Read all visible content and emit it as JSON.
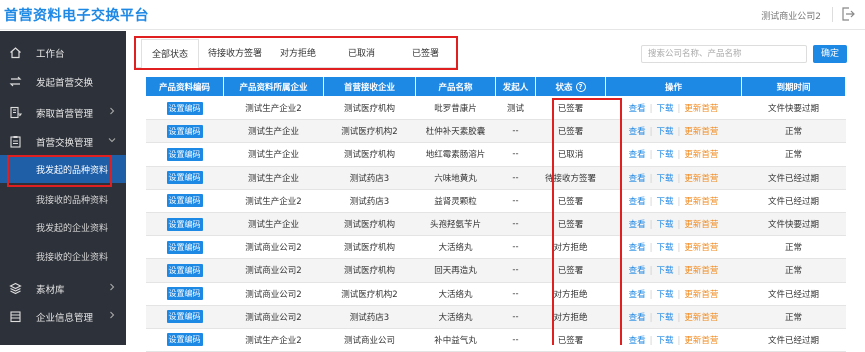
{
  "header": {
    "title": "首营资料电子交换平台",
    "company": "测试商业公司2"
  },
  "sidebar": {
    "items": [
      {
        "label": "工作台",
        "icon": "home-icon",
        "has_chevron": false
      },
      {
        "label": "发起首营交换",
        "icon": "exchange-icon",
        "has_chevron": false
      },
      {
        "label": "索取首营管理",
        "icon": "request-icon",
        "has_chevron": true
      },
      {
        "label": "首营交换管理",
        "icon": "clipboard-icon",
        "has_chevron": true,
        "expanded": true
      },
      {
        "label": "素材库",
        "icon": "layers-icon",
        "has_chevron": true
      },
      {
        "label": "企业信息管理",
        "icon": "building-icon",
        "has_chevron": true
      }
    ],
    "subitems": [
      {
        "label": "我发起的品种资料",
        "active": true
      },
      {
        "label": "我接收的品种资料",
        "active": false
      },
      {
        "label": "我发起的企业资料",
        "active": false
      },
      {
        "label": "我接收的企业资料",
        "active": false
      }
    ]
  },
  "tabs": [
    {
      "label": "全部状态",
      "active": true
    },
    {
      "label": "待接收方签署",
      "active": false
    },
    {
      "label": "对方拒绝",
      "active": false
    },
    {
      "label": "已取消",
      "active": false
    },
    {
      "label": "已签署",
      "active": false
    }
  ],
  "search": {
    "placeholder": "搜索公司名称、产品名称",
    "button_label": "确定"
  },
  "table": {
    "headers": [
      "产品资料编码",
      "产品资料所属企业",
      "首营接收企业",
      "产品名称",
      "发起人",
      "状态",
      "操作",
      "到期时间"
    ],
    "code_button_label": "设置编码",
    "actions": {
      "view": "查看",
      "download": "下载",
      "update": "更新首营"
    },
    "rows": [
      {
        "owner": "测试生产企业2",
        "receiver": "测试医疗机构",
        "product": "吡罗昔康片",
        "initiator": "测试",
        "status": "已签署",
        "expiry": "文件快要过期"
      },
      {
        "owner": "测试生产企业",
        "receiver": "测试医疗机构2",
        "product": "杜仲补天素胶囊",
        "initiator": "--",
        "status": "已签署",
        "expiry": "正常"
      },
      {
        "owner": "测试生产企业",
        "receiver": "测试医疗机构",
        "product": "地红霉素肠溶片",
        "initiator": "--",
        "status": "已取消",
        "expiry": "正常"
      },
      {
        "owner": "测试生产企业",
        "receiver": "测试药店3",
        "product": "六味地黄丸",
        "initiator": "--",
        "status": "待接收方签署",
        "expiry": "文件已经过期"
      },
      {
        "owner": "测试生产企业2",
        "receiver": "测试药店3",
        "product": "益肾灵颗粒",
        "initiator": "--",
        "status": "已签署",
        "expiry": "文件已经过期"
      },
      {
        "owner": "测试生产企业",
        "receiver": "测试医疗机构",
        "product": "头孢羟氨苄片",
        "initiator": "--",
        "status": "已签署",
        "expiry": "文件快要过期"
      },
      {
        "owner": "测试商业公司2",
        "receiver": "测试医疗机构",
        "product": "大活络丸",
        "initiator": "--",
        "status": "对方拒绝",
        "expiry": "正常"
      },
      {
        "owner": "测试商业公司2",
        "receiver": "测试医疗机构",
        "product": "回天再造丸",
        "initiator": "--",
        "status": "已签署",
        "expiry": "正常"
      },
      {
        "owner": "测试商业公司2",
        "receiver": "测试医疗机构2",
        "product": "大活络丸",
        "initiator": "--",
        "status": "对方拒绝",
        "expiry": "文件已经过期"
      },
      {
        "owner": "测试商业公司2",
        "receiver": "测试药店3",
        "product": "大活络丸",
        "initiator": "--",
        "status": "对方拒绝",
        "expiry": "正常"
      },
      {
        "owner": "测试生产企业2",
        "receiver": "测试商业公司",
        "product": "补中益气丸",
        "initiator": "--",
        "status": "已签署",
        "expiry": "文件已经过期"
      }
    ]
  },
  "colors": {
    "accent": "#1e88e5",
    "sidebar_bg": "#2d3139",
    "active_sub": "#1f5fa8",
    "highlight": "#e02020",
    "update_link": "#f28a1e"
  }
}
